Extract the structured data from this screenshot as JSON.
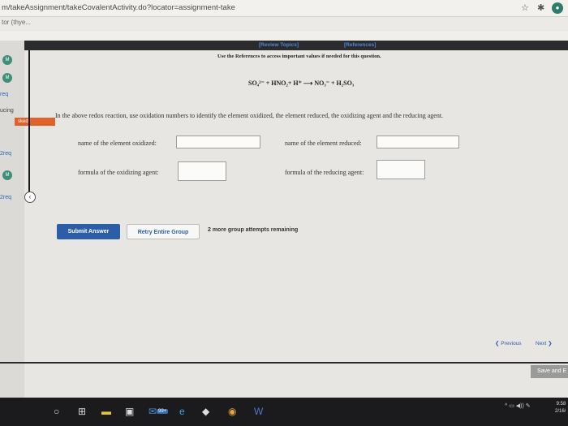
{
  "browser": {
    "url": "m/takeAssignment/takeCovalentActivity.do?locator=assignment-take",
    "tab_label": "tor (thye..."
  },
  "sidebar": {
    "items": [
      {
        "label": "M"
      },
      {
        "label": "M"
      },
      {
        "label": "req"
      },
      {
        "label": "ucing"
      },
      {
        "label": "sked"
      },
      {
        "label": "2req"
      },
      {
        "label": "M"
      },
      {
        "label": "2req"
      }
    ]
  },
  "header": {
    "review_topics": "[Review Topics]",
    "references": "[References]",
    "use_references": "Use the References to access important values if needed for this question."
  },
  "question": {
    "equation": "SO₄²⁻ + HNO₂+ H⁺ ⟶ NO₃⁻ + H₂SO₃",
    "prompt": "In the above redox reaction, use oxidation numbers to identify the element oxidized, the element reduced, the oxidizing agent and the reducing agent."
  },
  "fields": {
    "element_oxidized_label": "name of the element oxidized:",
    "element_reduced_label": "name of the element reduced:",
    "oxidizing_agent_label": "formula of the oxidizing agent:",
    "reducing_agent_label": "formula of the reducing agent:",
    "element_oxidized_value": "",
    "element_reduced_value": "",
    "oxidizing_agent_value": "",
    "reducing_agent_value": ""
  },
  "actions": {
    "submit": "Submit Answer",
    "retry": "Retry Entire Group",
    "attempts": "2 more group attempts remaining"
  },
  "nav": {
    "previous": "Previous",
    "next": "Next",
    "save": "Save and E"
  },
  "taskbar": {
    "badge": "99+",
    "clock_time": "9:58",
    "clock_date": "2/16/"
  },
  "colors": {
    "accent": "#2c5ea8",
    "link": "#4f86d8",
    "orange": "#e0622a",
    "teal": "#3e8e7a"
  }
}
